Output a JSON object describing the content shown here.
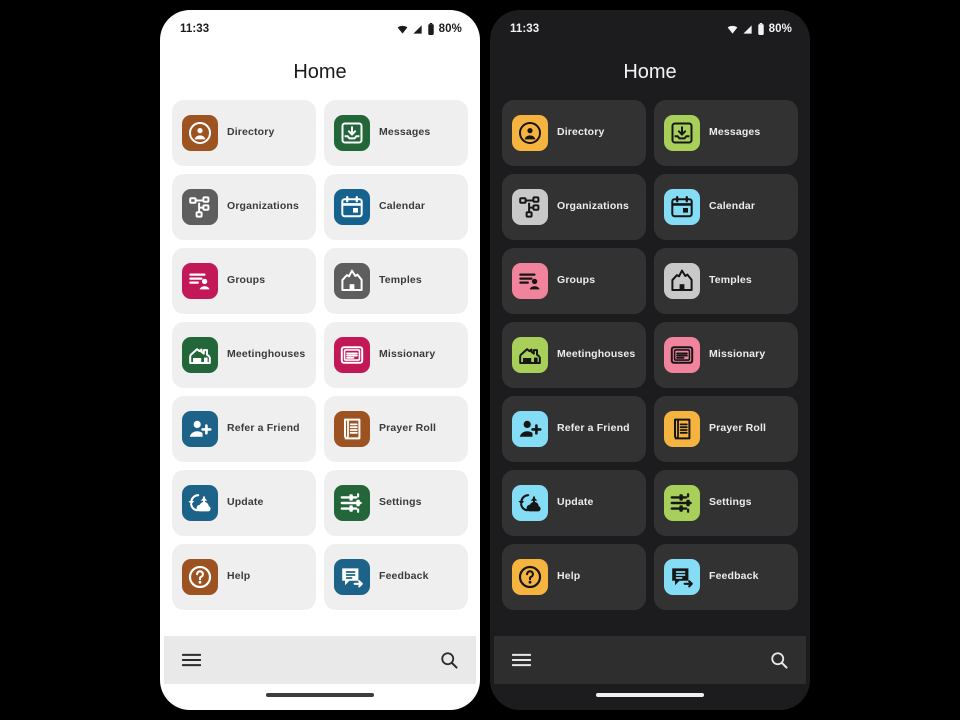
{
  "screenshot": {
    "description": "Android app Home screen shown side by side in light theme and dark theme"
  },
  "status_bar": {
    "time": "11:33",
    "battery_percent": "80%",
    "icons": [
      "wifi-icon",
      "signal-icon",
      "battery-icon"
    ]
  },
  "header": {
    "title": "Home"
  },
  "bottom_bar": {
    "menu_icon": "hamburger-menu-icon",
    "search_icon": "search-icon"
  },
  "grid": {
    "items": [
      {
        "label": "Directory",
        "icon": "person-circle-icon",
        "light_bg": "#9c5221",
        "light_fg": "#ffffff",
        "dark_bg": "#f5b33f",
        "dark_fg": "#161616"
      },
      {
        "label": "Messages",
        "icon": "inbox-download-icon",
        "light_bg": "#23663a",
        "light_fg": "#ffffff",
        "dark_bg": "#a8cf5a",
        "dark_fg": "#161616"
      },
      {
        "label": "Organizations",
        "icon": "org-chart-icon",
        "light_bg": "#5e5e5e",
        "light_fg": "#ffffff",
        "dark_bg": "#c9c9c9",
        "dark_fg": "#161616"
      },
      {
        "label": "Calendar",
        "icon": "calendar-icon",
        "light_bg": "#15628f",
        "light_fg": "#ffffff",
        "dark_bg": "#85dcf5",
        "dark_fg": "#161616"
      },
      {
        "label": "Groups",
        "icon": "contact-list-icon",
        "light_bg": "#c31858",
        "light_fg": "#ffffff",
        "dark_bg": "#f2839c",
        "dark_fg": "#161616"
      },
      {
        "label": "Temples",
        "icon": "temple-icon",
        "light_bg": "#5e5e5e",
        "light_fg": "#ffffff",
        "dark_bg": "#c9c9c9",
        "dark_fg": "#161616"
      },
      {
        "label": "Meetinghouses",
        "icon": "meetinghouse-icon",
        "light_bg": "#23663a",
        "light_fg": "#ffffff",
        "dark_bg": "#a8cf5a",
        "dark_fg": "#161616"
      },
      {
        "label": "Missionary",
        "icon": "message-card-icon",
        "light_bg": "#c31858",
        "light_fg": "#ffffff",
        "dark_bg": "#f2839c",
        "dark_fg": "#161616"
      },
      {
        "label": "Refer a Friend",
        "icon": "person-add-icon",
        "light_bg": "#1d6288",
        "light_fg": "#ffffff",
        "dark_bg": "#85dcf5",
        "dark_fg": "#161616"
      },
      {
        "label": "Prayer Roll",
        "icon": "prayer-scroll-icon",
        "light_bg": "#9c5221",
        "light_fg": "#ffffff",
        "dark_bg": "#f5b33f",
        "dark_fg": "#161616"
      },
      {
        "label": "Update",
        "icon": "cloud-sync-icon",
        "light_bg": "#1d6288",
        "light_fg": "#ffffff",
        "dark_bg": "#85dcf5",
        "dark_fg": "#161616"
      },
      {
        "label": "Settings",
        "icon": "sliders-icon",
        "light_bg": "#23663a",
        "light_fg": "#ffffff",
        "dark_bg": "#a8cf5a",
        "dark_fg": "#161616"
      },
      {
        "label": "Help",
        "icon": "question-circle-icon",
        "light_bg": "#9c5221",
        "light_fg": "#ffffff",
        "dark_bg": "#f5b33f",
        "dark_fg": "#161616"
      },
      {
        "label": "Feedback",
        "icon": "feedback-icon",
        "light_bg": "#1d6288",
        "light_fg": "#ffffff",
        "dark_bg": "#85dcf5",
        "dark_fg": "#161616"
      }
    ]
  },
  "themes": [
    {
      "name": "light",
      "page_bg": "#ffffff",
      "tile_bg": "#efefef",
      "text": "#3b3b3b",
      "bottom_bar_bg": "#e9e9e9"
    },
    {
      "name": "dark",
      "page_bg": "#1c1c1e",
      "tile_bg": "#323232",
      "text": "#ececec",
      "bottom_bar_bg": "#2e2e2e"
    }
  ]
}
